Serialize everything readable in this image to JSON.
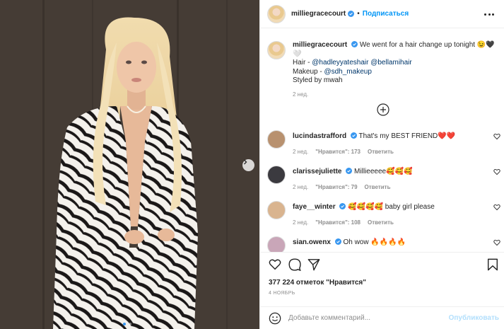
{
  "post": {
    "username": "milliegracecourt",
    "follow_label": "Подписаться",
    "bullet": "•",
    "caption": {
      "text": "We went for a hair change up tonight 😉🖤🤍",
      "hair_label": "Hair -",
      "hair_tag_1": "@hadleyyateshair",
      "hair_tag_2": "@bellamihair",
      "makeup_label": "Makeup -",
      "makeup_tag": "@sdh_makeup",
      "styled": "Styled by mwah",
      "time": "2 нед."
    },
    "likes": "377 224 отметок \"Нравится\"",
    "date": "4 НОЯБРЬ"
  },
  "comments": [
    {
      "username": "lucindastrafford",
      "text": "That's my BEST FRIEND❤️❤️",
      "time": "2 нед.",
      "likes": "\"Нравится\": 173",
      "reply": "Ответить",
      "avatar_color": "#b8916f"
    },
    {
      "username": "clarissejuliette",
      "text": "Millieeeee🥰🥰🥰",
      "time": "2 нед.",
      "likes": "\"Нравится\": 79",
      "reply": "Ответить",
      "avatar_color": "#3b3a3f"
    },
    {
      "username": "faye__winter",
      "text": "🥰🥰🥰🥰 baby girl please",
      "time": "2 нед.",
      "likes": "\"Нравится\": 108",
      "reply": "Ответить",
      "avatar_color": "#d9b48f"
    },
    {
      "username": "sian.owenx",
      "text": "Oh wow 🔥🔥🔥🔥",
      "avatar_color": "#c9a6b8"
    }
  ],
  "add_comment": {
    "placeholder": "Добавьте комментарий...",
    "publish_label": "Опубликовать"
  },
  "icons": [
    "heart-icon",
    "comment-icon",
    "share-icon",
    "bookmark-icon",
    "emoji-icon",
    "more-icon",
    "plus-circle-icon",
    "chevron-right-icon",
    "verified-icon"
  ],
  "colors": {
    "accent": "#0095f6",
    "link": "#00376b",
    "muted": "#8e8e8e",
    "verified": "#3897f0"
  }
}
